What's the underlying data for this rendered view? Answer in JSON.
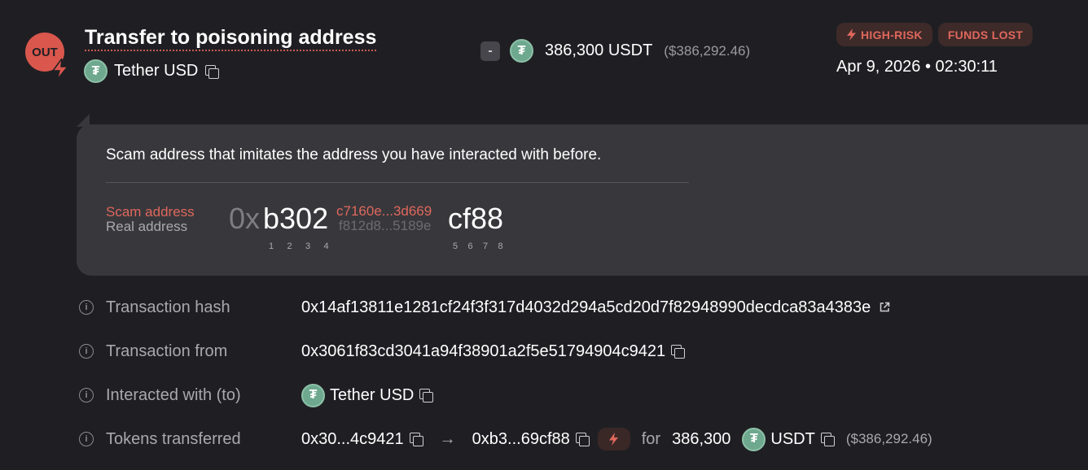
{
  "header": {
    "direction_badge": "OUT",
    "title": "Transfer to poisoning address",
    "token_name": "Tether USD",
    "token_symbol_glyph": "₮",
    "amount_sign": "-",
    "amount": "386,300 USDT",
    "amount_usd": "($386,292.46)",
    "badges": [
      "HIGH-RISK",
      "FUNDS LOST"
    ],
    "datetime": "Apr 9, 2026 • 02:30:11"
  },
  "warning": {
    "message": "Scam address that imitates the address you have interacted with before.",
    "scam_label": "Scam address",
    "real_label": "Real address",
    "prefix": "0x",
    "head": "b302",
    "scam_middle": "c7160e...3d669",
    "real_middle": "f812d8...5189e",
    "tail": "cf88",
    "head_positions": [
      "1",
      "2",
      "3",
      "4"
    ],
    "tail_positions": [
      "5",
      "6",
      "7",
      "8"
    ]
  },
  "details": {
    "tx_hash_label": "Transaction hash",
    "tx_hash": "0x14af13811e1281cf24f3f317d4032d294a5cd20d7f82948990decdca83a4383e",
    "tx_from_label": "Transaction from",
    "tx_from": "0x3061f83cd3041a94f38901a2f5e51794904c9421",
    "interacted_label": "Interacted with (to)",
    "interacted": "Tether USD",
    "tokens_label": "Tokens transferred",
    "tokens_from": "0x30...4c9421",
    "tokens_to": "0xb3...69cf88",
    "tokens_for": "for",
    "tokens_amount": "386,300",
    "tokens_symbol": "USDT",
    "tokens_usd": "($386,292.46)"
  },
  "colors": {
    "background": "#1f1f23",
    "panel": "#38383c",
    "danger": "#e0675c",
    "tether": "#6ea88f"
  },
  "icons": [
    "lightning-icon",
    "copy-icon",
    "external-link-icon",
    "info-icon",
    "tether-logo",
    "arrow-right-icon"
  ]
}
